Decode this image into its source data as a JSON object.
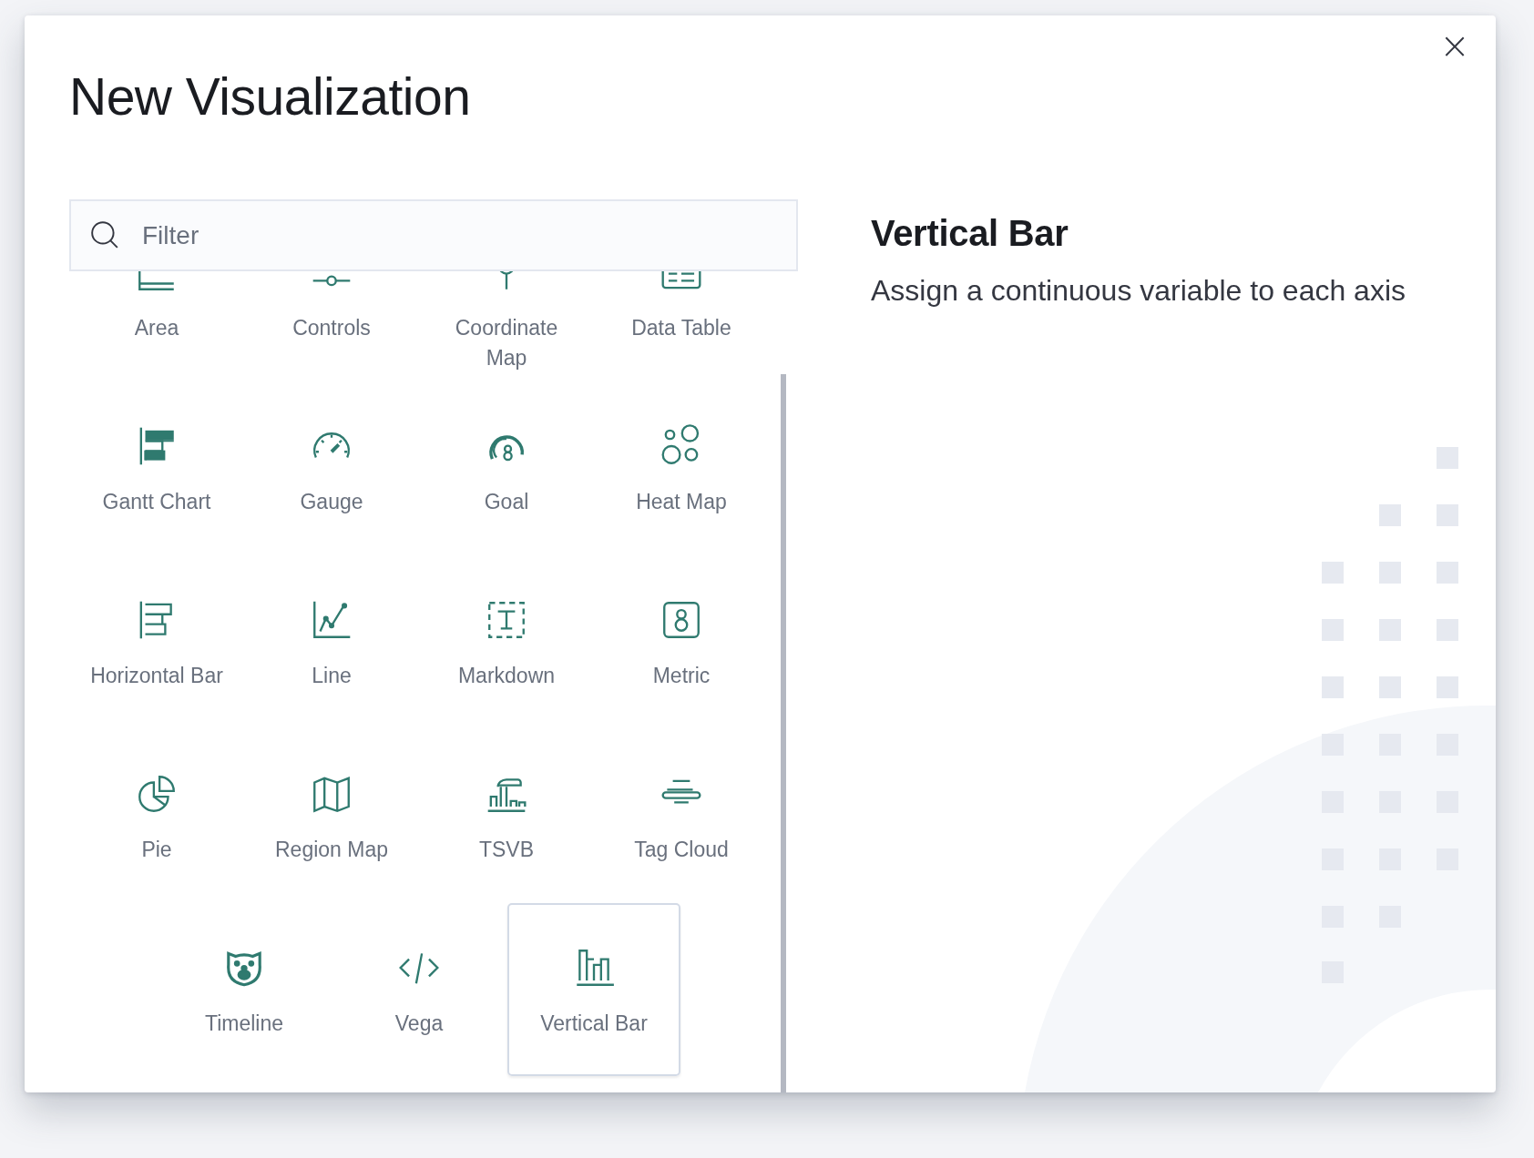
{
  "modal": {
    "title": "New Visualization",
    "close_label": "×"
  },
  "search": {
    "placeholder": "Filter"
  },
  "items": [
    {
      "label": "Area",
      "kind": "area",
      "selected": false
    },
    {
      "label": "Controls",
      "kind": "controls",
      "selected": false
    },
    {
      "label": "Coordinate Map",
      "kind": "coordinate",
      "selected": false
    },
    {
      "label": "Data Table",
      "kind": "table",
      "selected": false
    },
    {
      "label": "Gantt Chart",
      "kind": "gantt",
      "selected": false
    },
    {
      "label": "Gauge",
      "kind": "gauge",
      "selected": false
    },
    {
      "label": "Goal",
      "kind": "goal",
      "selected": false
    },
    {
      "label": "Heat Map",
      "kind": "heatmap",
      "selected": false
    },
    {
      "label": "Horizontal Bar",
      "kind": "hbar",
      "selected": false
    },
    {
      "label": "Line",
      "kind": "line",
      "selected": false
    },
    {
      "label": "Markdown",
      "kind": "markdown",
      "selected": false
    },
    {
      "label": "Metric",
      "kind": "metric",
      "selected": false
    },
    {
      "label": "Pie",
      "kind": "pie",
      "selected": false
    },
    {
      "label": "Region Map",
      "kind": "regionmap",
      "selected": false
    },
    {
      "label": "TSVB",
      "kind": "tsvb",
      "selected": false
    },
    {
      "label": "Tag Cloud",
      "kind": "tagcloud",
      "selected": false
    },
    {
      "label": "Timeline",
      "kind": "timeline",
      "selected": false
    },
    {
      "label": "Vega",
      "kind": "vega",
      "selected": false
    },
    {
      "label": "Vertical Bar",
      "kind": "vbar",
      "selected": true
    }
  ],
  "detail": {
    "title": "Vertical Bar",
    "description": "Assign a continuous variable to each axis"
  }
}
